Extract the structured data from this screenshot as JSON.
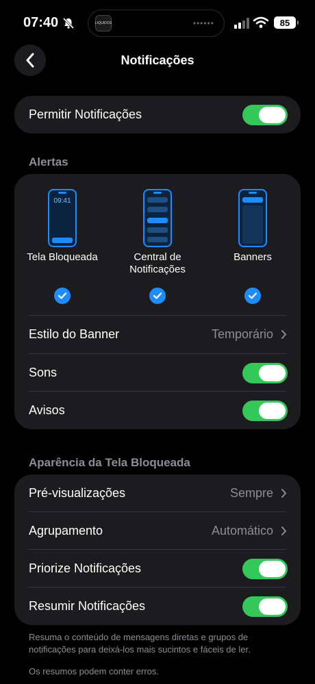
{
  "status": {
    "time": "07:40",
    "battery": "85",
    "island_app_label": "LIQUIDOS"
  },
  "nav": {
    "title": "Notificações"
  },
  "allow": {
    "label": "Permitir Notificações",
    "enabled": true
  },
  "alerts": {
    "header": "Alertas",
    "lock_time": "09:41",
    "options": [
      {
        "label": "Tela Bloqueada",
        "checked": true
      },
      {
        "label": "Central de Notificações",
        "checked": true
      },
      {
        "label": "Banners",
        "checked": true
      }
    ],
    "banner_style": {
      "label": "Estilo do Banner",
      "value": "Temporário"
    },
    "sounds": {
      "label": "Sons",
      "enabled": true
    },
    "badges": {
      "label": "Avisos",
      "enabled": true
    }
  },
  "lockscreen": {
    "header": "Aparência da Tela Bloqueada",
    "previews": {
      "label": "Pré-visualizações",
      "value": "Sempre"
    },
    "grouping": {
      "label": "Agrupamento",
      "value": "Automático"
    },
    "prioritize": {
      "label": "Priorize Notificações",
      "enabled": true
    },
    "summarize": {
      "label": "Resumir Notificações",
      "enabled": true
    }
  },
  "footer": {
    "text1": "Resuma o conteúdo de mensagens diretas e grupos de notificações para deixá-los mais sucintos e fáceis de ler.",
    "text2": "Os resumos podem conter erros."
  }
}
